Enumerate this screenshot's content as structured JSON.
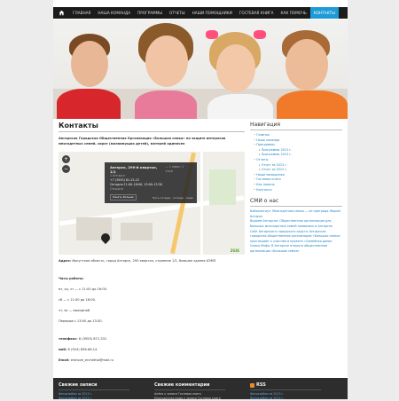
{
  "nav": {
    "items": [
      {
        "label": "ГЛАВНАЯ",
        "active": false
      },
      {
        "label": "НАША КОМАНДА",
        "active": false
      },
      {
        "label": "ПРОГРАММЫ",
        "active": false
      },
      {
        "label": "ОТЧЕТЫ",
        "active": false
      },
      {
        "label": "НАШИ ПОМОЩНИКИ",
        "active": false
      },
      {
        "label": "ГОСТЕВАЯ КНИГА",
        "active": false
      },
      {
        "label": "КАК ПОМОЧЬ",
        "active": false
      },
      {
        "label": "КОНТАКТЫ",
        "active": true
      }
    ]
  },
  "main": {
    "title": "Контакты",
    "intro": "Ангарская Городская Общественная Организация «Большая семья» по защите интересов многодетных семей, сирот (малоимущих детей), матерей одиночек",
    "map": {
      "address": "Ангарск, 290-й квартал, 1/1",
      "address_meta": "— 1 офис; 1 этаж",
      "city": "1 Ангарск",
      "phone": "+7 (3955) 61-15-23",
      "hours": "Сегодня 11:00–18:00, 13:00–13:30",
      "status": "Открыто",
      "btn_more": "Узнать больше",
      "btn_route": "Путь отсюда · отсюда · сюда",
      "zoom_in": "+",
      "zoom_out": "−",
      "provider": "2GIS"
    },
    "address_label": "Адрес:",
    "address_value": "Иркутская область, город Ангарск, 290 квартал, строение 1/1, бывшее здание АЭМЗ",
    "hours_title": "Часы работы:",
    "hours": [
      "вт, ср, чт — с 11:00 до 16:00.",
      "сб — с 11:00 до 16:00.",
      "чт, вс — выходной",
      "Перерыв с 13:00 до 13:30."
    ],
    "phone_label": "телефакс:",
    "phone_value": "8 (3955) 671-331",
    "mobile_label": "моб:",
    "mobile_value": "8 (924) 836-66-14",
    "email_label": "Email:",
    "email_value": "ershove_erchettia@mail.ru"
  },
  "sidebar": {
    "nav_title": "Навигация",
    "nav_items": [
      {
        "label": "Главная",
        "level": 1
      },
      {
        "label": "Наша команда",
        "level": 1
      },
      {
        "label": "Программы",
        "level": 1
      },
      {
        "label": "Программы 2013 г.",
        "level": 2
      },
      {
        "label": "Программы 2013 г.",
        "level": 2
      },
      {
        "label": "Отчеты",
        "level": 1
      },
      {
        "label": "Отчет за 2013 г.",
        "level": 2
      },
      {
        "label": "Отчет за 2012 г.",
        "level": 2
      },
      {
        "label": "Наши помощники",
        "level": 1
      },
      {
        "label": "Гостевая книга",
        "level": 1
      },
      {
        "label": "Как помочь",
        "level": 1
      },
      {
        "label": "Контакты",
        "level": 1
      }
    ],
    "media_title": "СМИ о нас",
    "media_items": [
      "Байкальтиус: Многодетная семья — не преграда Жарой Ангарск",
      "Ведоем Ангарска: Общественная организация для больших многодетных семей появилась в Ангарске",
      "Сайт Ангарского городского округа: Ангарская городская общественная организация «Большая семья» приглашает к участию в проекте «Семейная дома»",
      "Семья Инфо: В Ангарске открыта общественная организация «Большая семья»"
    ]
  },
  "footer": {
    "col1_title": "Свежие записи",
    "col1_items": [
      "Фотоальбом за 2013 г.",
      "Фотоальбом за 2012 г."
    ],
    "col2_title": "Свежие комментарии",
    "col2_items": [
      "Алёна к записи Гостевая книга",
      "Многодетная мама к записи Гостевая книга"
    ],
    "col3_title": "RSS",
    "col3_items": [
      "Фотоальбом за 2013 г.",
      "Фотоальбом за 2012 г."
    ]
  }
}
